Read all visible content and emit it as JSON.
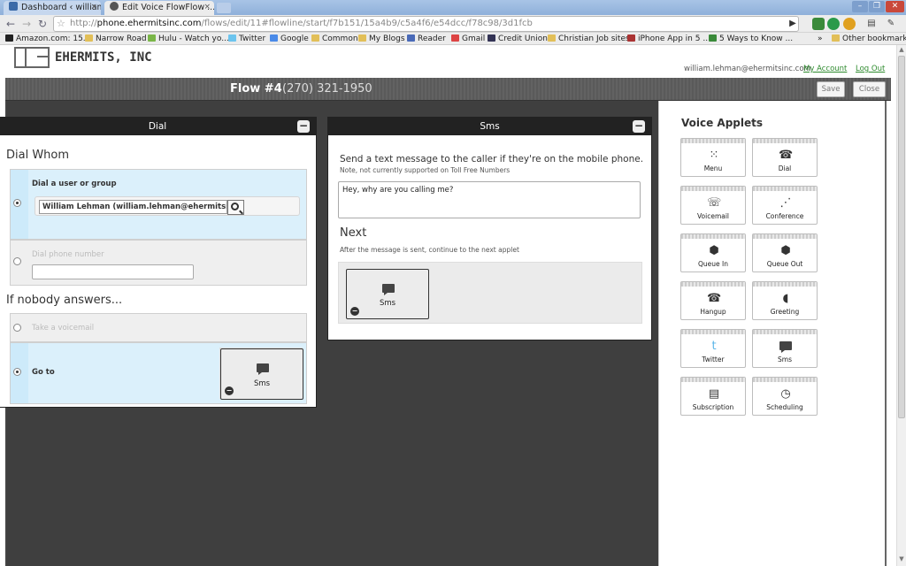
{
  "browser": {
    "tabs": [
      {
        "label": "Dashboard ‹ williaml...",
        "active": false
      },
      {
        "label": "Edit Voice FlowFlow ...",
        "active": true
      }
    ],
    "close_glyph": "×",
    "url_prefix": "http://",
    "url_domain": "phone.ehermitsinc.com",
    "url_path": "/flows/edit/11#flowline/start/f7b151/15a4b9/c5a4f6/e54dcc/f78c98/3d1fcb",
    "bookmarks": [
      {
        "label": "Amazon.com: 15...",
        "icon": "amazon-icon"
      },
      {
        "label": "Narrow Road",
        "icon": "folder-icon"
      },
      {
        "label": "Hulu - Watch yo...",
        "icon": "hulu-icon"
      },
      {
        "label": "Twitter",
        "icon": "twitter-icon"
      },
      {
        "label": "Google",
        "icon": "google-icon"
      },
      {
        "label": "Common",
        "icon": "folder-icon"
      },
      {
        "label": "My Blogs",
        "icon": "folder-icon"
      },
      {
        "label": "Reader",
        "icon": "reader-icon"
      },
      {
        "label": "Gmail",
        "icon": "gmail-icon"
      },
      {
        "label": "Credit Union",
        "icon": "credit-union-icon"
      },
      {
        "label": "Christian Job sites",
        "icon": "folder-icon"
      },
      {
        "label": "iPhone App in 5 ...",
        "icon": "iphone-app-icon"
      },
      {
        "label": "5 Ways to Know ...",
        "icon": "page-icon"
      },
      {
        "label": "Other bookmarks",
        "icon": "folder-icon"
      }
    ],
    "bookmarks_overflow": "»"
  },
  "header": {
    "logo_text": "EHERMITS, INC",
    "user_email": "william.lehman@ehermitsinc.com",
    "my_account": "My Account",
    "log_out": "Log Out"
  },
  "flow": {
    "title": "Flow #4",
    "phone": "(270) 321-1950",
    "save_label": "Save",
    "close_label": "Close"
  },
  "dial_panel": {
    "title": "Dial",
    "section_whom": "Dial Whom",
    "option_user": "Dial a user or group",
    "user_value": "William Lehman (william.lehman@ehermitsinc.com)",
    "option_phone": "Dial phone number",
    "section_nobody": "If nobody answers...",
    "option_voicemail": "Take a voicemail",
    "option_goto": "Go to",
    "goto_applet": "Sms"
  },
  "sms_panel": {
    "title": "Sms",
    "instruction": "Send a text message to the caller if they're on the mobile phone.",
    "note": "Note, not currently supported on Toll Free Numbers",
    "message": "Hey, why are you calling me?",
    "next_title": "Next",
    "next_note": "After the message is sent, continue to the next applet",
    "next_applet": "Sms"
  },
  "sidebar": {
    "title": "Voice Applets",
    "applets": [
      {
        "label": "Menu",
        "icon": "keypad-icon"
      },
      {
        "label": "Dial",
        "icon": "phone-handset-icon"
      },
      {
        "label": "Voicemail",
        "icon": "voicemail-icon"
      },
      {
        "label": "Conference",
        "icon": "conference-icon"
      },
      {
        "label": "Queue In",
        "icon": "queue-in-icon"
      },
      {
        "label": "Queue Out",
        "icon": "queue-out-icon"
      },
      {
        "label": "Hangup",
        "icon": "hangup-icon"
      },
      {
        "label": "Greeting",
        "icon": "greeting-icon"
      },
      {
        "label": "Twitter",
        "icon": "twitter-icon"
      },
      {
        "label": "Sms",
        "icon": "sms-icon"
      },
      {
        "label": "Subscription",
        "icon": "subscription-icon"
      },
      {
        "label": "Scheduling",
        "icon": "clock-icon"
      }
    ]
  },
  "colors": {
    "selected_option_bg": "#dbf0fb",
    "link_green": "#2e8b2e",
    "panel_header": "#222222"
  }
}
